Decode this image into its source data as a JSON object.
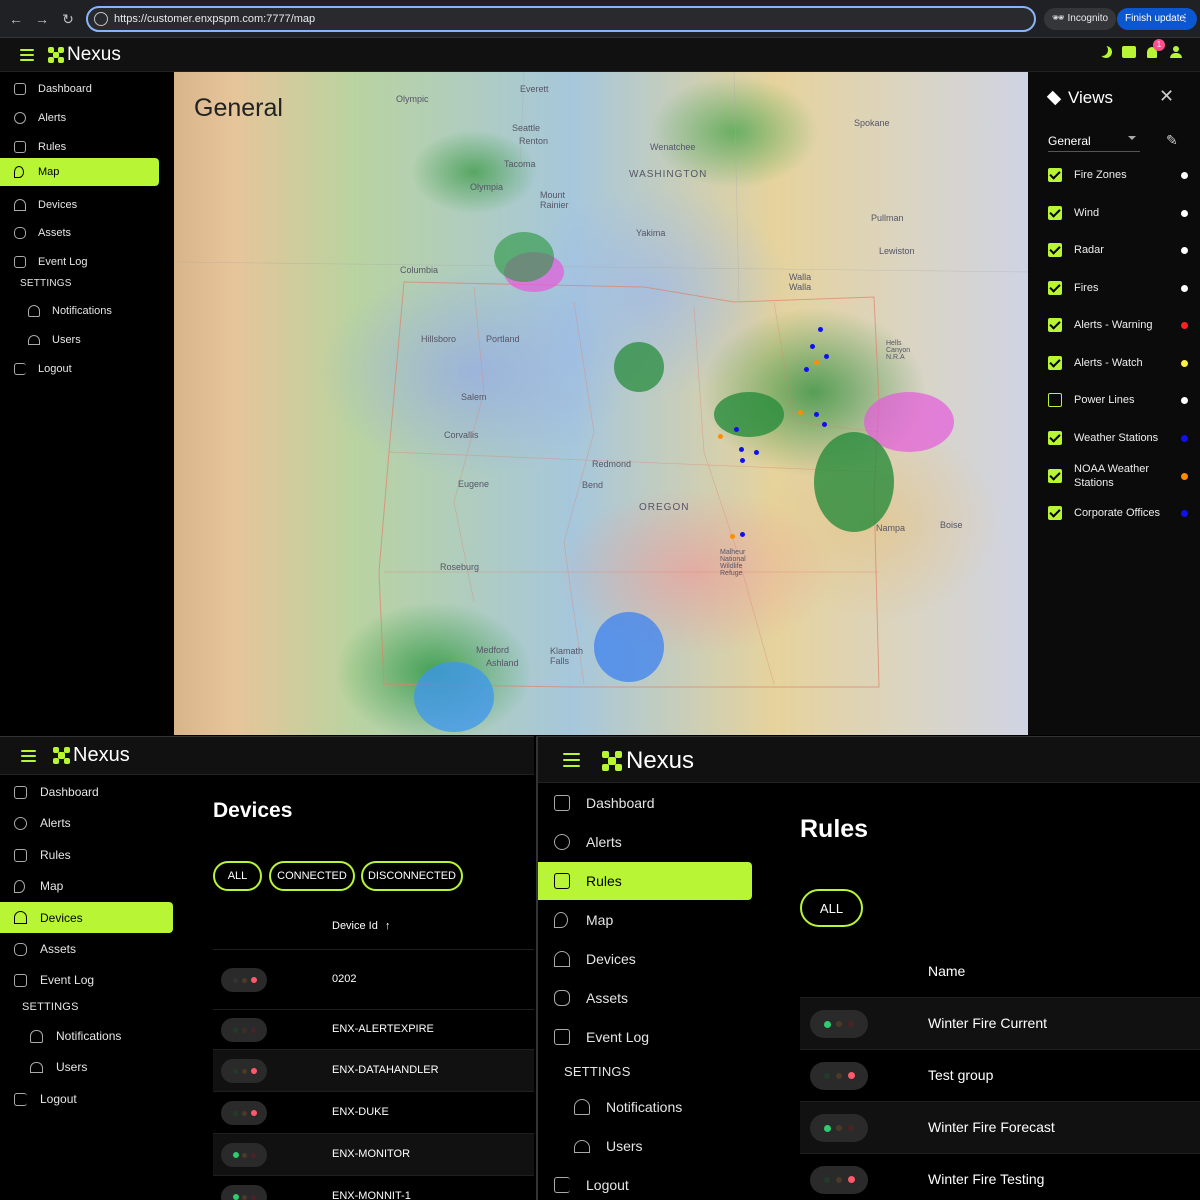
{
  "browser": {
    "url": "https://customer.enxpspm.com:7777/map",
    "incognito_label": "Incognito",
    "finish_update_label": "Finish update"
  },
  "app": {
    "brand": "Nexus",
    "accent": "#b7f535",
    "notification_count": "1"
  },
  "nav": {
    "dashboard": "Dashboard",
    "alerts": "Alerts",
    "rules": "Rules",
    "map": "Map",
    "devices": "Devices",
    "assets": "Assets",
    "event_log": "Event Log",
    "settings": "SETTINGS",
    "notifications": "Notifications",
    "users": "Users",
    "logout": "Logout"
  },
  "map": {
    "title": "General",
    "labels": [
      "Olympic",
      "Everett",
      "Seattle",
      "Renton",
      "Tacoma",
      "Olympia",
      "Mount Rainier",
      "Wenatchee",
      "WASHINGTON",
      "Spokane",
      "Yakima",
      "Pullman",
      "Lewiston",
      "Walla Walla",
      "Columbia",
      "Hillsboro",
      "Portland",
      "Salem",
      "Corvallis",
      "Eugene",
      "Redmond",
      "Bend",
      "OREGON",
      "Roseburg",
      "Medford",
      "Ashland",
      "Klamath Falls",
      "Nampa",
      "Boise",
      "Malheur National Wildlife Refuge",
      "Hells Canyon N.R.A"
    ]
  },
  "views": {
    "title": "Views",
    "selected": "General",
    "layers": [
      {
        "label": "Fire Zones",
        "checked": true,
        "color": "#ffffff"
      },
      {
        "label": "Wind",
        "checked": true,
        "color": "#ffffff"
      },
      {
        "label": "Radar",
        "checked": true,
        "color": "#ffffff"
      },
      {
        "label": "Fires",
        "checked": true,
        "color": "#ffffff"
      },
      {
        "label": "Alerts - Warning",
        "checked": true,
        "color": "#ff2020"
      },
      {
        "label": "Alerts - Watch",
        "checked": true,
        "color": "#ffee44"
      },
      {
        "label": "Power Lines",
        "checked": false,
        "color": "#ffffff"
      },
      {
        "label": "Weather Stations",
        "checked": true,
        "color": "#1010ee"
      },
      {
        "label": "NOAA Weather Stations",
        "checked": true,
        "color": "#ff8c00"
      },
      {
        "label": "Corporate Offices",
        "checked": true,
        "color": "#1010ee"
      }
    ]
  },
  "devices": {
    "title": "Devices",
    "filters": [
      "ALL",
      "CONNECTED",
      "DISCONNECTED"
    ],
    "column": "Device Id",
    "rows": [
      {
        "id": "0202",
        "status": "red"
      },
      {
        "id": "ENX-ALERTEXPIRE",
        "status": "none"
      },
      {
        "id": "ENX-DATAHANDLER",
        "status": "red"
      },
      {
        "id": "ENX-DUKE",
        "status": "red"
      },
      {
        "id": "ENX-MONITOR",
        "status": "green"
      },
      {
        "id": "ENX-MONNIT-1",
        "status": "green"
      }
    ]
  },
  "rules": {
    "title": "Rules",
    "filters": [
      "ALL"
    ],
    "column": "Name",
    "rows": [
      {
        "name": "Winter Fire Current",
        "status": "green"
      },
      {
        "name": "Test group",
        "status": "red"
      },
      {
        "name": "Winter Fire Forecast",
        "status": "green"
      },
      {
        "name": "Winter Fire Testing",
        "status": "red"
      }
    ]
  }
}
